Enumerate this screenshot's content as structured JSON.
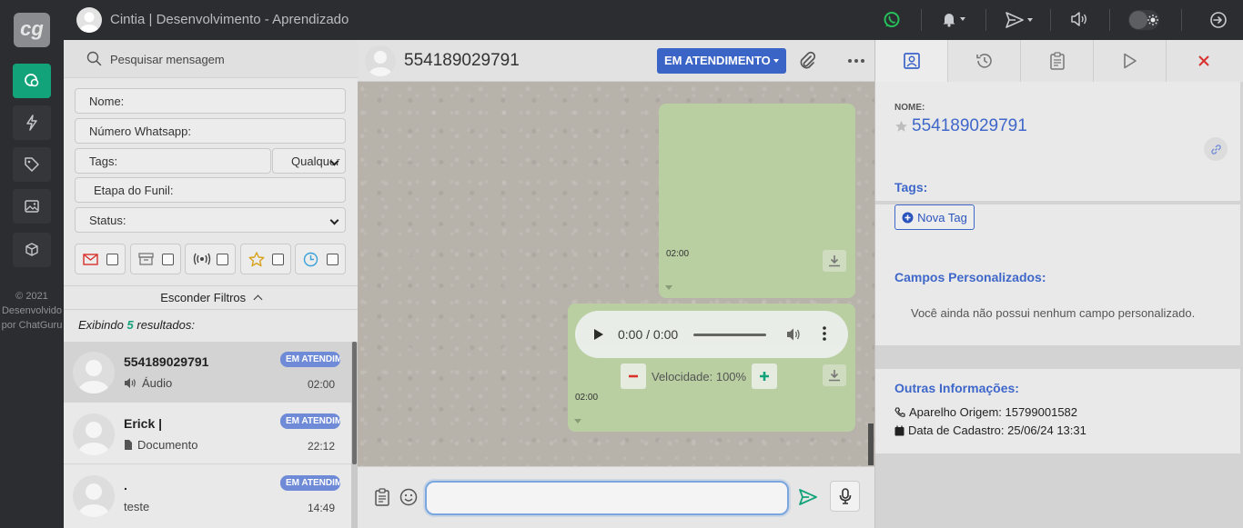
{
  "app": {
    "logo_text": "cg",
    "footer": [
      "© 2021",
      "Desenvolvido",
      "por ChatGuru"
    ]
  },
  "topbar": {
    "user_title": "Cintia | Desenvolvimento - Aprendizado"
  },
  "rail": {
    "items": [
      "chat-icon",
      "lightning-icon",
      "tag-icon",
      "image-icon",
      "cube-icon"
    ]
  },
  "left": {
    "search_placeholder": "Pesquisar mensagem",
    "filters": {
      "name": "Nome:",
      "whatsapp": "Número Whatsapp:",
      "tags": "Tags:",
      "tags_mode": "Qualquer",
      "funnel": "Etapa do Funil:",
      "status": "Status:"
    },
    "hide_filters": "Esconder Filtros",
    "results_prefix": "Exibindo",
    "results_count": "5",
    "results_suffix": "resultados:",
    "conversations": [
      {
        "name": "554189029791",
        "badge": "EM ATENDIMENTO",
        "preview": "Áudio",
        "preview_icon": "speaker-icon",
        "time": "02:00"
      },
      {
        "name": "Erick |",
        "badge": "EM ATENDIMENTO",
        "preview": "Documento",
        "preview_icon": "document-icon",
        "time": "22:12"
      },
      {
        "name": ".",
        "badge": "EM ATENDIMENTO",
        "preview": "teste",
        "preview_icon": "",
        "time": "14:49"
      }
    ]
  },
  "chat": {
    "title": "554189029791",
    "status_button": "EM ATENDIMENTO",
    "messages": [
      {
        "type": "media",
        "time": "02:00"
      },
      {
        "type": "audio",
        "player_time": "0:00 / 0:00",
        "speed_label": "Velocidade: 100%",
        "time": "02:00"
      }
    ],
    "input_value": ""
  },
  "right": {
    "name_label": "NOME:",
    "name": "554189029791",
    "tags_title": "Tags:",
    "new_tag": "Nova Tag",
    "custom_title": "Campos Personalizados:",
    "custom_empty": "Você ainda não possui nenhum campo personalizado.",
    "other_title": "Outras Informações:",
    "device_origin": "Aparelho Origem: 15799001582",
    "registered": "Data de Cadastro: 25/06/24 13:31"
  },
  "colors": {
    "accent_green": "#13a37a",
    "primary_blue": "#3b64c7",
    "badge_blue": "#6f8ad6",
    "bubble_green": "#b9cfa2",
    "delete_red": "#d9302c"
  }
}
